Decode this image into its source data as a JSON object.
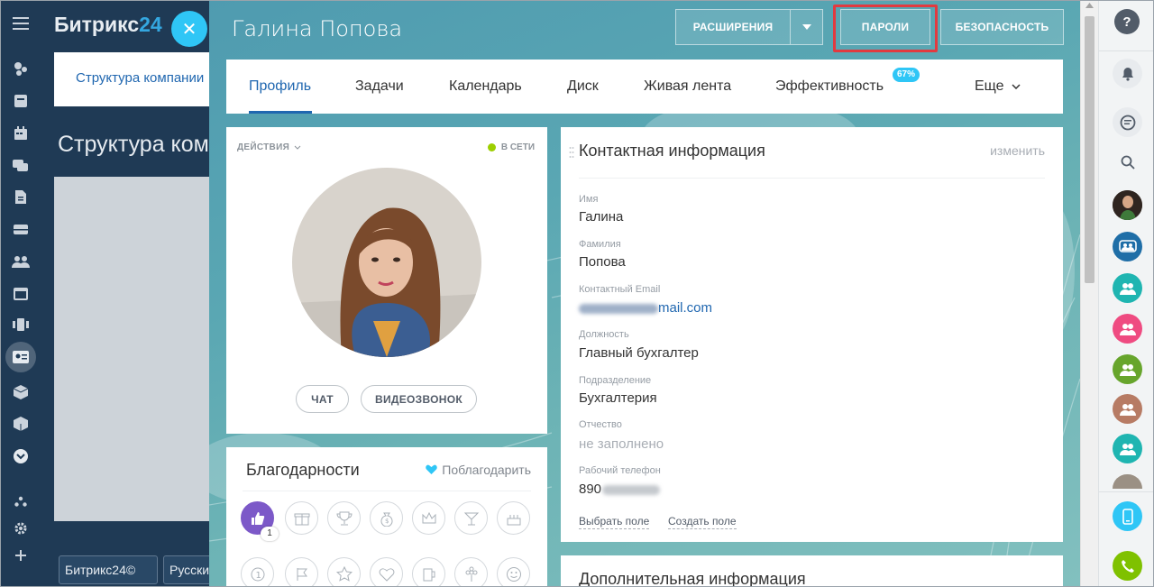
{
  "background": {
    "logo_text": "Битрикс",
    "logo_num": "24",
    "tab_label": "Структура компании",
    "heading": "Структура компании",
    "footer_logo": "Битрикс24©",
    "footer_lang": "Русский"
  },
  "sidebar": {
    "icons": [
      "menu-icon",
      "activity-icon",
      "feed-icon",
      "calendar-icon",
      "chat-icon",
      "document-icon",
      "drive-icon",
      "group-icon",
      "sites-icon",
      "apps-icon",
      "employees-icon",
      "cube-icon",
      "box-icon",
      "more-icon",
      "structure-icon",
      "settings-icon",
      "add-icon"
    ]
  },
  "header": {
    "title": "Галина Попова",
    "btn_extensions": "РАСШИРЕНИЯ",
    "btn_passwords": "ПАРОЛИ",
    "btn_security": "БЕЗОПАСНОСТЬ"
  },
  "tabs": {
    "profile": "Профиль",
    "tasks": "Задачи",
    "calendar": "Календарь",
    "disk": "Диск",
    "feed": "Живая лента",
    "efficiency": "Эффективность",
    "efficiency_badge": "67%",
    "more": "Еще"
  },
  "profile": {
    "actions": "ДЕЙСТВИЯ",
    "status": "В СЕТИ",
    "btn_chat": "ЧАТ",
    "btn_video": "ВИДЕОЗВОНОК"
  },
  "thanks": {
    "title": "Благодарности",
    "link": "Поблагодарить",
    "first_count": "1",
    "icons": [
      "thumbs-up-icon",
      "gift-icon",
      "cup-icon",
      "money-icon",
      "crown-icon",
      "cocktail-icon",
      "cake-icon",
      "number-one-icon",
      "flag-icon",
      "star-icon",
      "heart-icon",
      "beer-icon",
      "flower-icon",
      "smile-icon"
    ]
  },
  "contact": {
    "title": "Контактная информация",
    "edit": "изменить",
    "fields": [
      {
        "label": "Имя",
        "value": "Галина"
      },
      {
        "label": "Фамилия",
        "value": "Попова"
      },
      {
        "label": "Контактный Email",
        "value": "mail.com"
      },
      {
        "label": "Должность",
        "value": "Главный бухгалтер"
      },
      {
        "label": "Подразделение",
        "value": "Бухгалтерия"
      },
      {
        "label": "Отчество",
        "value": "не заполнено"
      },
      {
        "label": "Рабочий телефон",
        "value": "890"
      }
    ],
    "link_select": "Выбрать поле",
    "link_create": "Создать поле"
  },
  "additional": {
    "title": "Дополнительная информация"
  },
  "rightbar": {
    "items": [
      "help-icon",
      "notifications-icon",
      "messenger-icon",
      "search-icon",
      "user-avatar",
      "group-chat",
      "user-teal-1",
      "user-pink",
      "user-green",
      "user-brown",
      "user-teal-2",
      "user-avatar-2",
      "phone-icon",
      "call-icon"
    ]
  },
  "colors": {
    "accent": "#2067b0",
    "bitrix_blue": "#2fc6f6",
    "highlight": "#e23a40",
    "online": "#9dcf00"
  }
}
